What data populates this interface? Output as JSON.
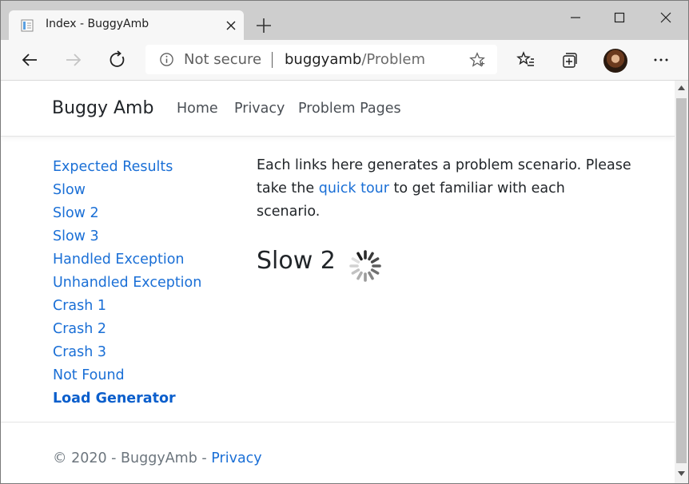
{
  "browser": {
    "tab_title": "Index - BuggyAmb",
    "address": {
      "security_label": "Not secure",
      "host": "buggyamb",
      "path": "/Problem"
    }
  },
  "site": {
    "brand": "Buggy Amb",
    "nav": [
      "Home",
      "Privacy",
      "Problem Pages"
    ],
    "sidebar": [
      "Expected Results",
      "Slow",
      "Slow 2",
      "Slow 3",
      "Handled Exception",
      "Unhandled Exception",
      "Crash 1",
      "Crash 2",
      "Crash 3",
      "Not Found",
      "Load Generator"
    ],
    "intro": {
      "before": "Each links here generates a problem scenario. Please take the ",
      "link": "quick tour",
      "after": " to get familiar with each scenario."
    },
    "heading": "Slow 2",
    "footer": {
      "text": "© 2020 - BuggyAmb - ",
      "link": "Privacy"
    }
  },
  "colors": {
    "link": "#1a6fd6",
    "text": "#212529",
    "muted": "#6c757d",
    "tabstrip": "#cecece"
  }
}
